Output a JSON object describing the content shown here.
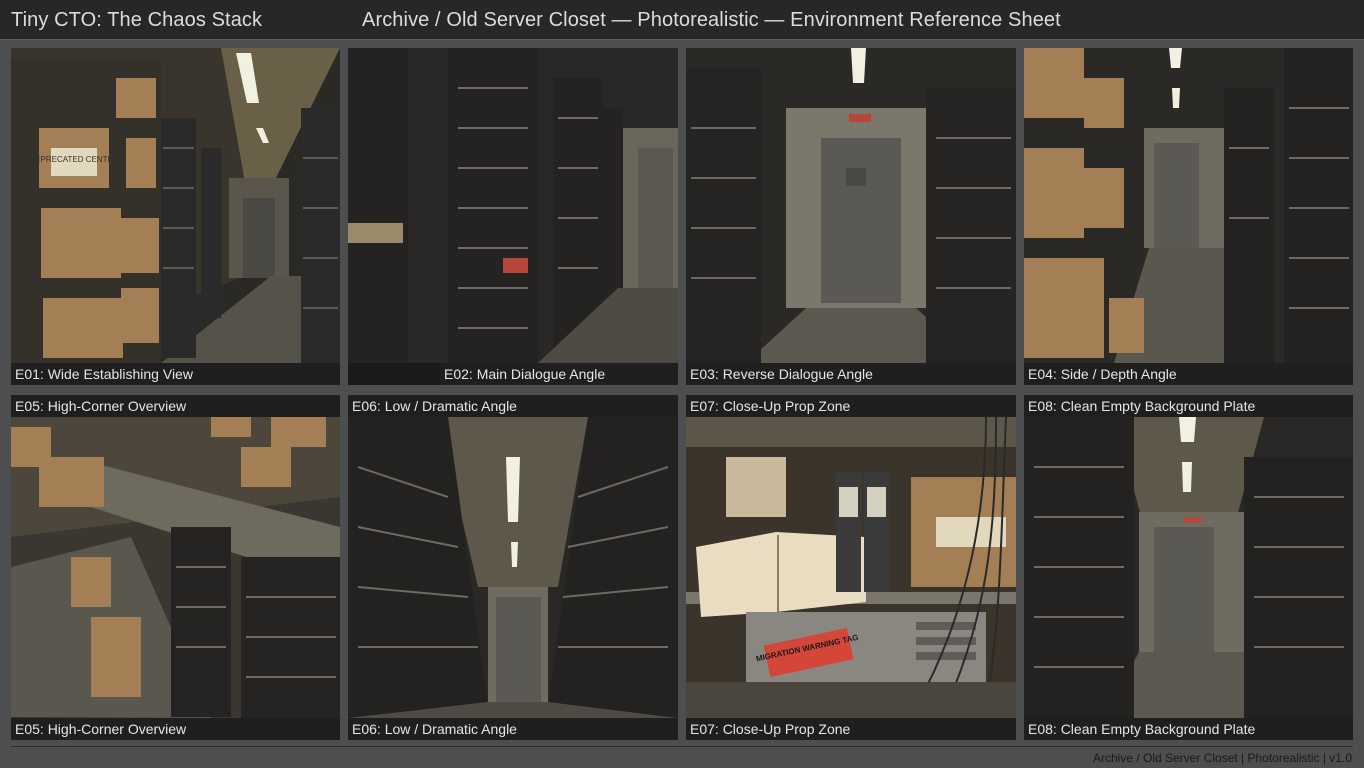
{
  "header": {
    "project_title": "Tiny CTO: The Chaos Stack",
    "sheet_title": "Archive / Old Server Closet — Photorealistic — Environment Reference Sheet"
  },
  "panels": [
    {
      "id": "E01",
      "caption": "E01: Wide Establishing View",
      "box_text": "DEPRECATED CENTER"
    },
    {
      "id": "E02",
      "caption": "E02: Main Dialogue Angle"
    },
    {
      "id": "E03",
      "caption": "E03: Reverse Dialogue Angle"
    },
    {
      "id": "E04",
      "caption": "E04: Side / Depth Angle"
    },
    {
      "id": "E05",
      "top_label": "E05: High-Corner Overview",
      "caption": "E05: High-Corner Overview"
    },
    {
      "id": "E06",
      "top_label": "E06: Low / Dramatic Angle",
      "caption": "E06: Low / Dramatic Angle"
    },
    {
      "id": "E07",
      "top_label": "E07: Close-Up Prop Zone",
      "caption": "E07: Close-Up Prop Zone",
      "tag_text": "MIGRATION WARNING TAG"
    },
    {
      "id": "E08",
      "top_label": "E08: Clean Empty Background Plate",
      "caption": "E08: Clean Empty Background Plate"
    }
  ],
  "footer": {
    "text": "Archive / Old Server Closet | Photorealistic | v1.0"
  },
  "colors": {
    "background": "#4d4e4f",
    "header_bar": "#262727",
    "caption_bar": "#1f1f1f",
    "caption_text": "#e6e6e6"
  }
}
